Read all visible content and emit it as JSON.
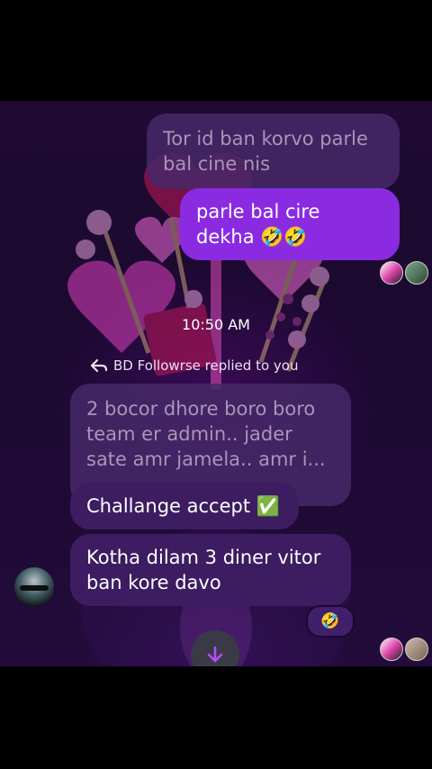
{
  "messages": {
    "faded_top": "Tor id ban korvo parle bal cine nis",
    "sent_1": "parle bal cire dekha 🤣🤣",
    "timestamp": "10:50 AM",
    "reply_indicator": "BD Followrse replied to you",
    "quoted_reply": "2 bocor dhore boro boro team er admin.. jader sate amr jamela..  amr i...",
    "recv_1": "Challange accept ✅",
    "recv_2": "Kotha dilam 3 diner vitor ban kore davo",
    "reaction_emoji": "🤣"
  },
  "icons": {
    "reply": "reply-arrow-icon",
    "scroll_down": "arrow-down-icon"
  },
  "colors": {
    "sent_bubble": "#8a2be2",
    "recv_bubble": "#3d1c62",
    "background": "#1e0a32",
    "accent": "#b44cff"
  }
}
